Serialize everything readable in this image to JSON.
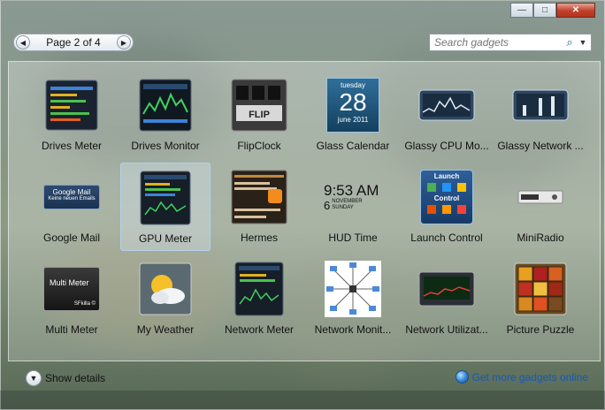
{
  "pager": {
    "label": "Page 2 of 4",
    "prev_icon": "chevron-left-icon",
    "next_icon": "chevron-right-icon"
  },
  "search": {
    "placeholder": "Search gadgets",
    "icon": "search-icon",
    "dropdown_icon": "chevron-down-icon"
  },
  "window_controls": [
    "minimize-icon",
    "maximize-icon",
    "close-icon"
  ],
  "gadgets": [
    {
      "label": "Drives Meter",
      "icon": "drives-meter-icon"
    },
    {
      "label": "Drives Monitor",
      "icon": "drives-monitor-icon"
    },
    {
      "label": "FlipClock",
      "icon": "flipclock-icon"
    },
    {
      "label": "Glass Calendar",
      "icon": "glass-calendar-icon",
      "day": "tuesday",
      "date": "28",
      "month": "june 2011"
    },
    {
      "label": "Glassy CPU Mo...",
      "icon": "glassy-cpu-icon"
    },
    {
      "label": "Glassy Network ...",
      "icon": "glassy-network-icon"
    },
    {
      "label": "Google Mail",
      "icon": "google-mail-icon",
      "title": "Google Mail",
      "subtitle": "Keine neuen Emails"
    },
    {
      "label": "GPU Meter",
      "icon": "gpu-meter-icon",
      "selected": true
    },
    {
      "label": "Hermes",
      "icon": "hermes-icon"
    },
    {
      "label": "HUD Time",
      "icon": "hud-time-icon",
      "time": "9:53 AM",
      "day": "6",
      "month": "NOVEMBER",
      "weekday": "SUNDAY"
    },
    {
      "label": "Launch Control",
      "icon": "launch-control-icon",
      "top": "Launch",
      "bottom": "Control"
    },
    {
      "label": "MiniRadio",
      "icon": "miniradio-icon"
    },
    {
      "label": "Multi Meter",
      "icon": "multi-meter-icon",
      "title": "Multi Meter",
      "brand": "SFkilla ©"
    },
    {
      "label": "My Weather",
      "icon": "weather-icon"
    },
    {
      "label": "Network Meter",
      "icon": "network-meter-icon"
    },
    {
      "label": "Network Monit...",
      "icon": "network-monitor-icon"
    },
    {
      "label": "Network Utilizat...",
      "icon": "network-utilization-icon"
    },
    {
      "label": "Picture Puzzle",
      "icon": "picture-puzzle-icon"
    }
  ],
  "footer": {
    "details_label": "Show details",
    "more_label": "Get more gadgets online"
  },
  "colors": {
    "link": "#1459b8",
    "close": "#c0402a"
  }
}
